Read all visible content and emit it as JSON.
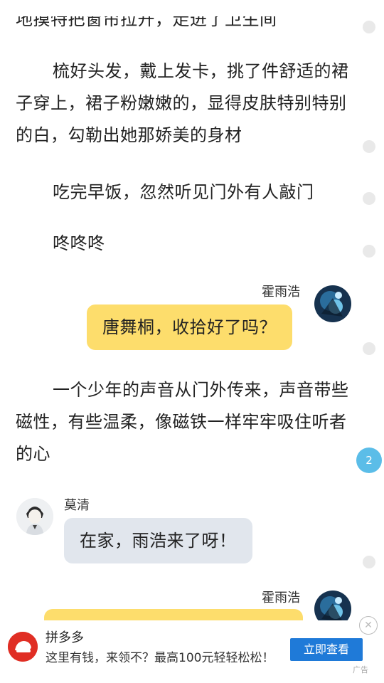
{
  "story": {
    "paragraphs_top": [
      "地摸特把窗帘拉开，走进了卫生间",
      "梳好头发，戴上发卡，挑了件舒适的裙子穿上，裙子粉嫩嫩的，显得皮肤特别特别的白，勾勒出她那娇美的身材",
      "吃完早饭，忽然听见门外有人敲门",
      "咚咚咚"
    ],
    "paragraph_mid": "一个少年的声音从门外传来，声音带些磁性，有些温柔，像磁铁一样牢牢吸住听者的心"
  },
  "chat": [
    {
      "speaker": "霍雨浩",
      "text": "唐舞桐，收拾好了吗？",
      "side": "right"
    },
    {
      "speaker": "莫清",
      "text": "在家，雨浩来了呀！",
      "side": "left"
    },
    {
      "speaker": "霍雨浩",
      "text": "",
      "side": "right"
    }
  ],
  "comment_badge": "2",
  "ad": {
    "title": "拼多多",
    "description": "这里有钱，来领不？最高100元轻轻松松！",
    "button": "立即查看",
    "close": "✕",
    "tag": "广告"
  }
}
